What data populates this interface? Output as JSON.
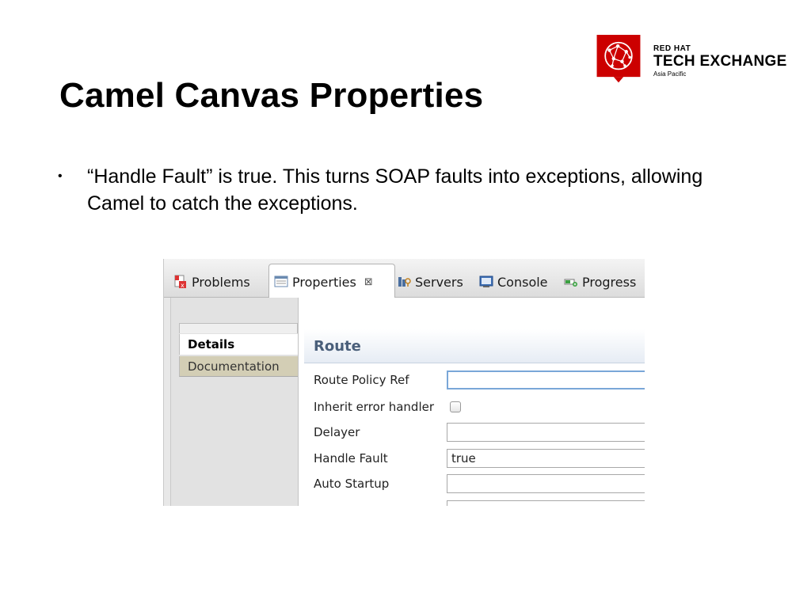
{
  "slide": {
    "title": "Camel Canvas Properties",
    "bullet": "“Handle Fault” is true. This turns SOAP faults into exceptions, allowing Camel to catch the exceptions.",
    "bullet_marker": "•"
  },
  "logo": {
    "line1": "RED HAT",
    "line2": "TECH EXCHANGE",
    "line3": "Asia Pacific",
    "color": "#cc0000"
  },
  "eclipse": {
    "tabs": [
      {
        "label": "Problems",
        "icon": "problems-icon"
      },
      {
        "label": "Properties",
        "icon": "properties-icon",
        "active": true
      },
      {
        "label": "Servers",
        "icon": "servers-icon"
      },
      {
        "label": "Console",
        "icon": "console-icon"
      },
      {
        "label": "Progress",
        "icon": "progress-icon"
      }
    ],
    "close_glyph": "⊠",
    "sidebar": [
      "Details",
      "Documentation"
    ],
    "section_title": "Route",
    "fields": [
      {
        "label": "Route Policy Ref",
        "value": ""
      },
      {
        "label": "Inherit error handler",
        "checked": false
      },
      {
        "label": "Delayer",
        "value": ""
      },
      {
        "label": "Handle Fault",
        "value": "true"
      },
      {
        "label": "Auto Startup",
        "value": ""
      }
    ]
  }
}
